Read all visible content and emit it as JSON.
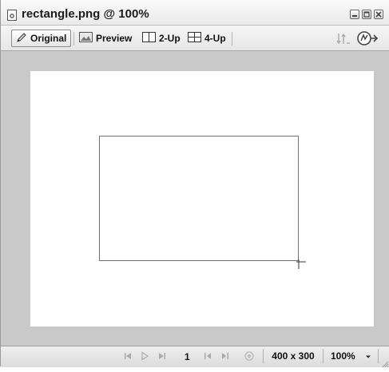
{
  "window": {
    "title": "rectangle.png @ 100%"
  },
  "toolbar": {
    "tabs": [
      {
        "label": "Original",
        "icon": "pencil-icon",
        "active": true
      },
      {
        "label": "Preview",
        "icon": "image-preview-icon",
        "active": false
      },
      {
        "label": "2-Up",
        "icon": "two-up-icon",
        "active": false
      },
      {
        "label": "4-Up",
        "icon": "four-up-icon",
        "active": false
      }
    ],
    "right_icons": [
      "optimize-icon",
      "export-icon"
    ]
  },
  "statusbar": {
    "frame": "1",
    "dimensions": "400 x 300",
    "zoom": "100%"
  },
  "colors": {
    "canvas_bg": "#c9c9c9",
    "document_bg": "#ffffff",
    "shape_stroke": "#707070"
  }
}
